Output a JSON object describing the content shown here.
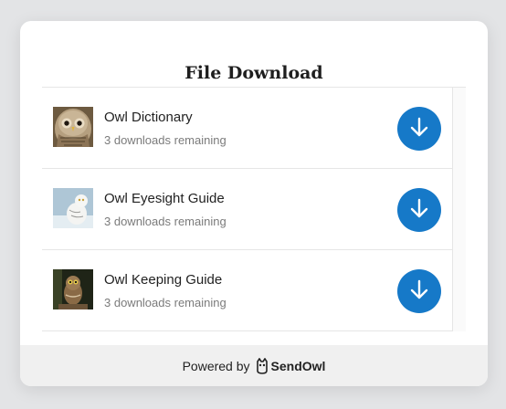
{
  "dialog": {
    "title": "File Download"
  },
  "files": [
    {
      "name": "Owl Dictionary",
      "remaining": "3 downloads remaining",
      "thumbnail": "barred-owl-thumbnail",
      "download_icon": "download-arrow-icon"
    },
    {
      "name": "Owl Eyesight Guide",
      "remaining": "3 downloads remaining",
      "thumbnail": "snowy-owl-thumbnail",
      "download_icon": "download-arrow-icon"
    },
    {
      "name": "Owl Keeping Guide",
      "remaining": "3 downloads remaining",
      "thumbnail": "little-owl-thumbnail",
      "download_icon": "download-arrow-icon"
    }
  ],
  "footer": {
    "powered_by": "Powered by",
    "brand": "SendOwl",
    "brand_icon": "sendowl-logo-icon"
  },
  "colors": {
    "accent": "#1679c8",
    "background": "#e3e4e6",
    "footer": "#f0f0f0"
  }
}
